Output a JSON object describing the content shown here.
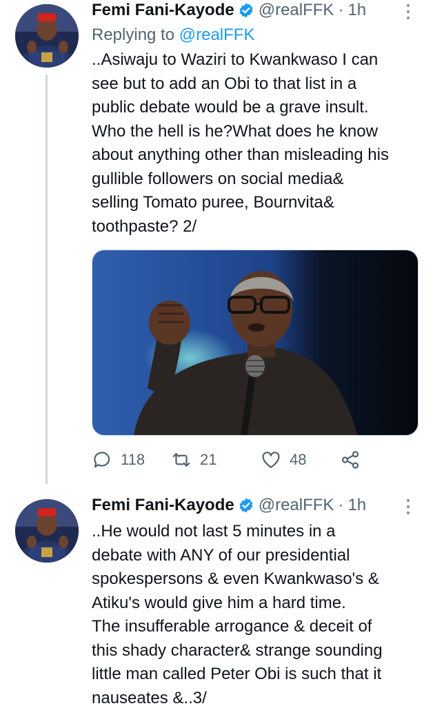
{
  "colors": {
    "link": "#1d9bf0",
    "muted": "#536471",
    "text": "#0f1419",
    "verified": "#1d9bf0"
  },
  "tweets": [
    {
      "author": {
        "name": "Femi Fani-Kayode",
        "handle": "@realFFK",
        "verified": true,
        "avatar_icon": "profile-photo"
      },
      "separator": "·",
      "time": "1h",
      "reply_prefix": "Replying to ",
      "reply_mention": "@realFFK",
      "text": "..Asiwaju to Waziri to Kwankwaso I can\nsee but to add an Obi to that list in a\npublic debate would be a grave insult.\nWho the hell is he?What does he know\nabout anything other than misleading his\ngullible followers on social media&\nselling Tomato puree, Bournvita&\ntoothpaste? 2/",
      "media": {
        "type": "photo",
        "subject": "man with glasses speaking into microphone, fist raised"
      },
      "actions": {
        "replies": "118",
        "retweets": "21",
        "likes": "48"
      }
    },
    {
      "author": {
        "name": "Femi Fani-Kayode",
        "handle": "@realFFK",
        "verified": true,
        "avatar_icon": "profile-photo"
      },
      "separator": "·",
      "time": "1h",
      "text": "..He would not last 5 minutes in a\ndebate with ANY of our presidential\nspokespersons & even Kwankwaso's &\nAtiku's would give him a hard time.\nThe insufferable arrogance & deceit of\nthis shady character& strange sounding\nlittle man called Peter Obi is such that it\nnauseates &..3/"
    }
  ]
}
